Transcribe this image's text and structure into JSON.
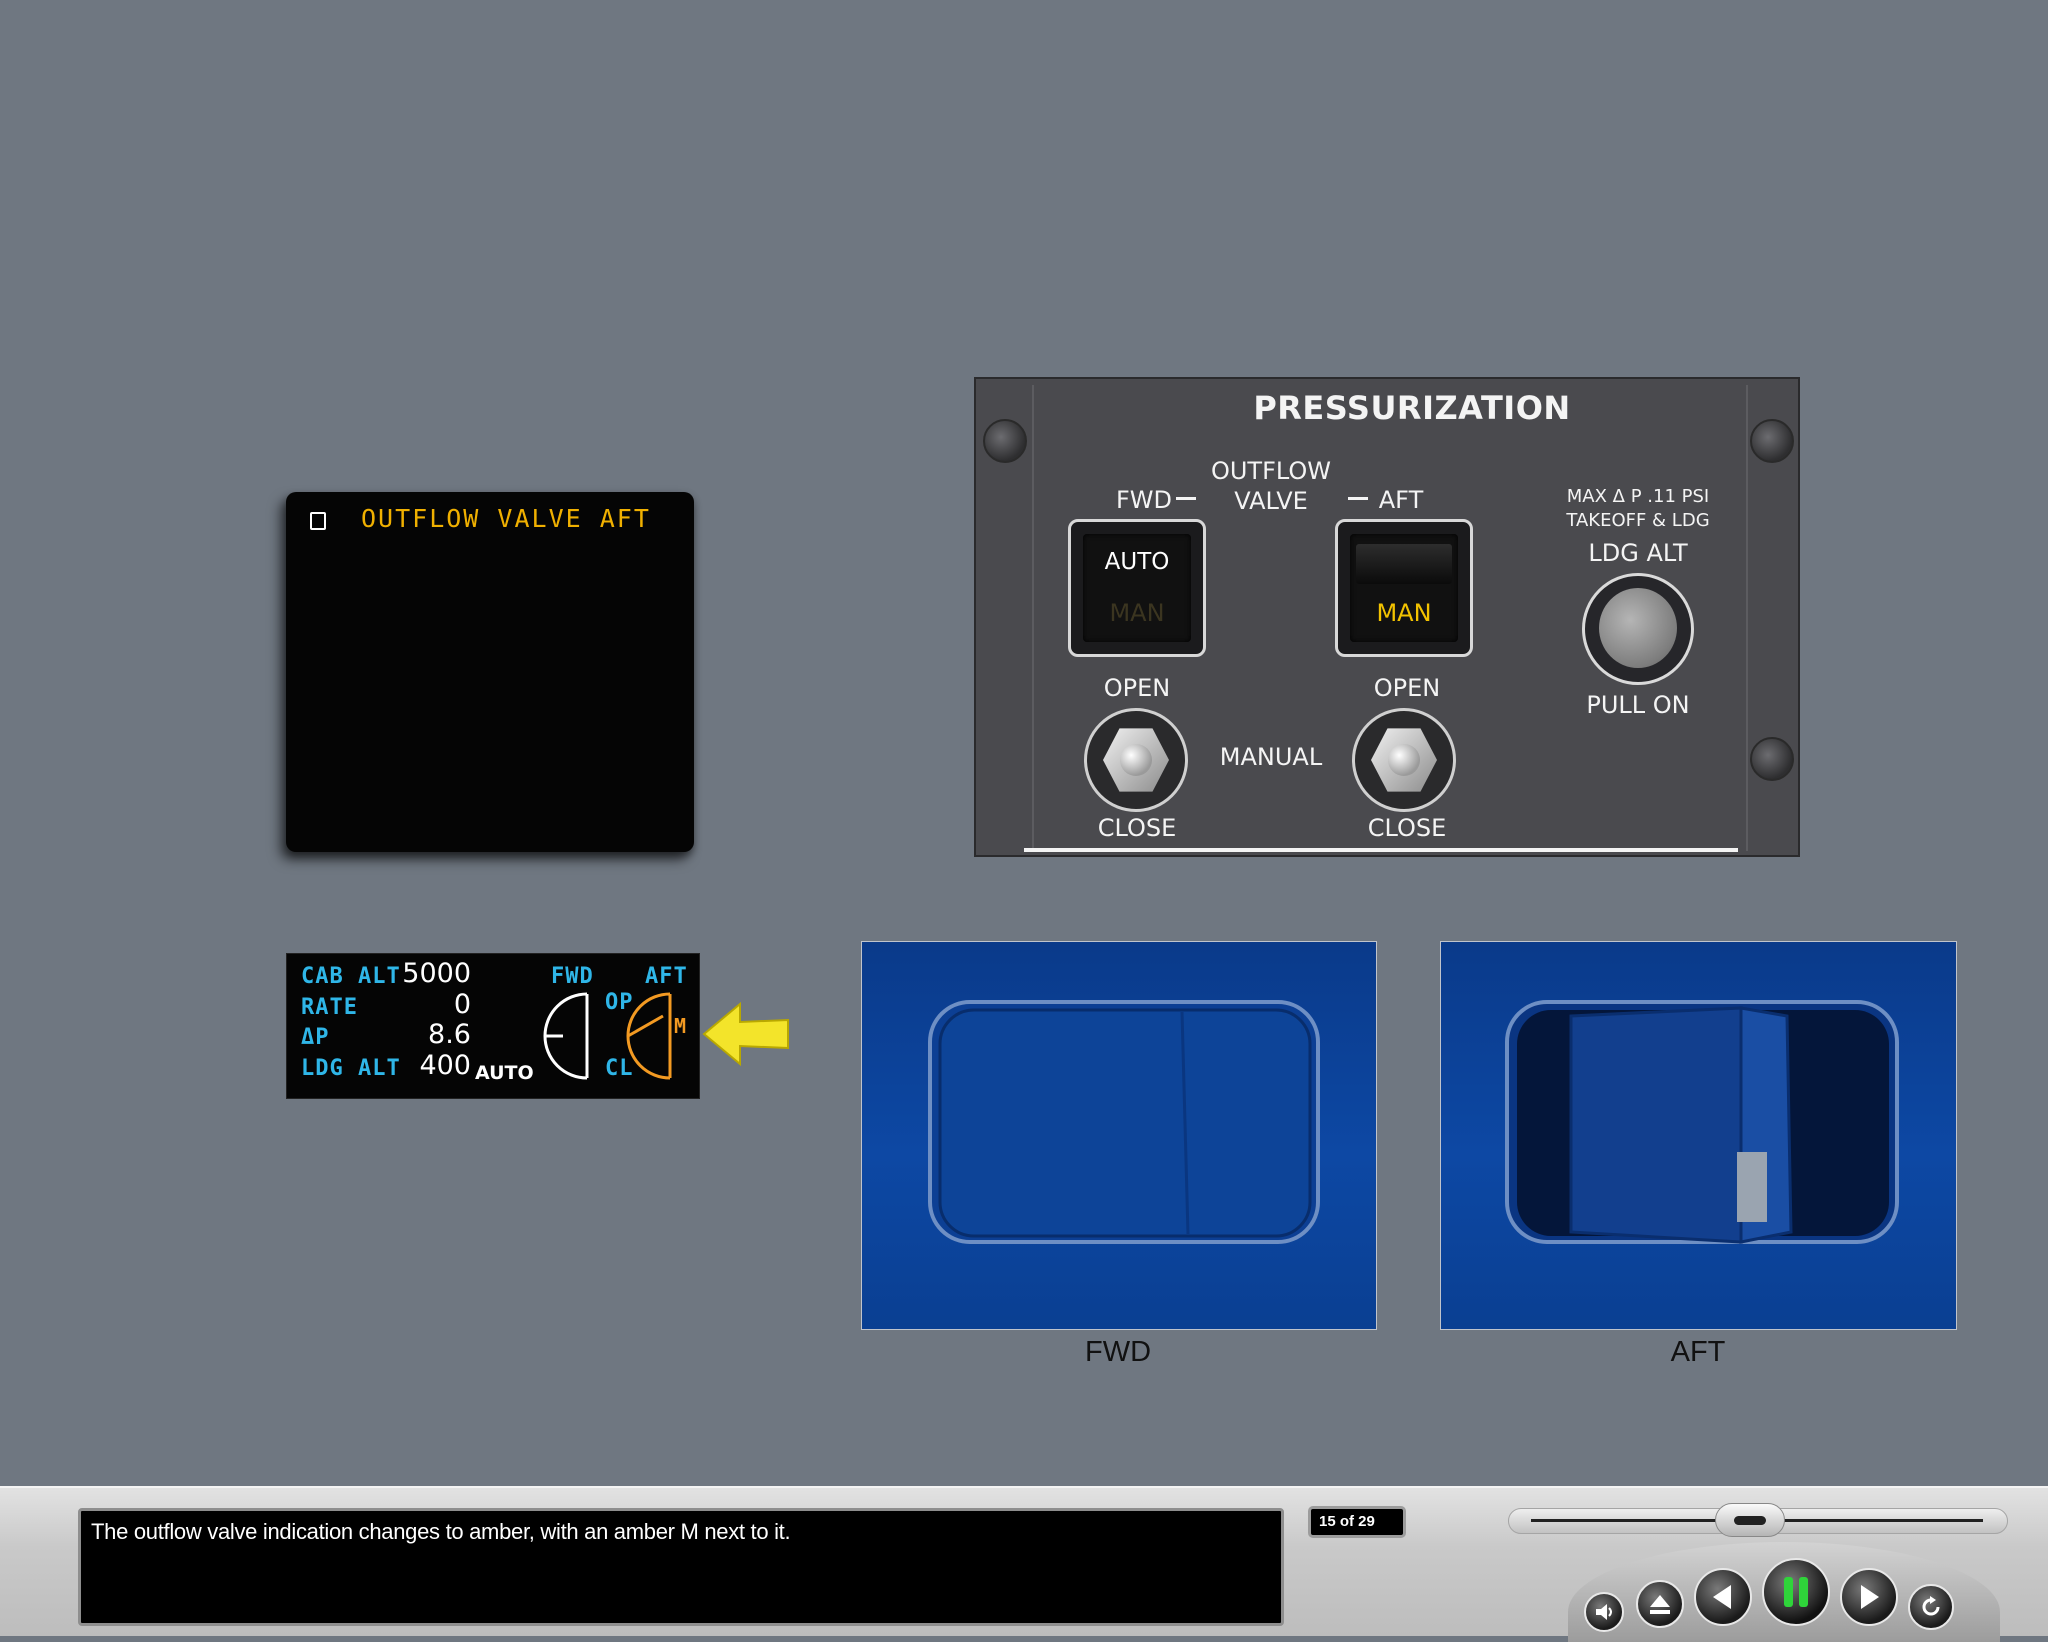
{
  "eicas_message": {
    "text": "OUTFLOW VALVE AFT",
    "color": "#f0b000"
  },
  "pressurization_panel": {
    "title": "PRESSURIZATION",
    "outflow_valve_label_1": "OUTFLOW",
    "outflow_valve_label_2": "VALVE",
    "fwd_label": "FWD",
    "aft_label": "AFT",
    "fwd_switch": {
      "top": "AUTO",
      "bottom": "MAN"
    },
    "aft_switch": {
      "bottom": "MAN"
    },
    "open_label": "OPEN",
    "close_label": "CLOSE",
    "manual_label": "MANUAL",
    "max_dp_label": "MAX Δ P .11 PSI",
    "takeoff_ldg_label": "TAKEOFF & LDG",
    "ldg_alt_label": "LDG ALT",
    "pull_on_label": "PULL ON"
  },
  "synoptic": {
    "cab_alt_label": "CAB ALT",
    "cab_alt_value": "5000",
    "rate_label": "RATE",
    "rate_value": "0",
    "dp_label": "ΔP",
    "dp_value": "8.6",
    "ldg_alt_label": "LDG ALT",
    "ldg_alt_value": "400",
    "auto_label": "AUTO",
    "fwd_label": "FWD",
    "aft_label": "AFT",
    "op_label": "OP",
    "cl_label": "CL",
    "m_label": "M",
    "amber": "#f39a22",
    "cyan": "#2fb6e8"
  },
  "photos": {
    "fwd_caption": "FWD",
    "aft_caption": "AFT"
  },
  "player": {
    "caption": "The outflow valve indication changes to amber, with an amber M next to it.",
    "page_counter": "15 of 29",
    "progress": 0.48
  }
}
